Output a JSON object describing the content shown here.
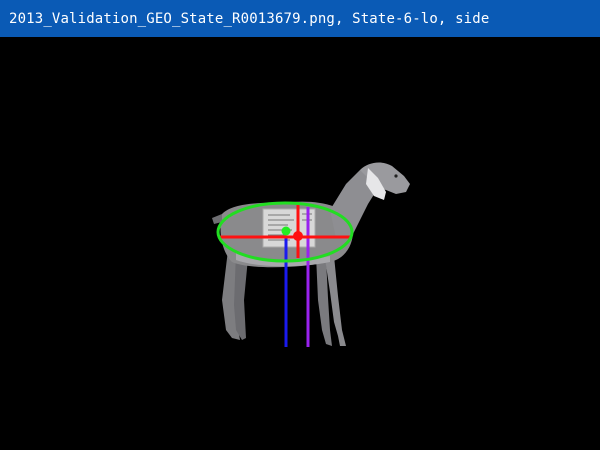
{
  "window": {
    "title": "2013_Validation_GEO_State_R0013679.png, State-6-lo, side"
  },
  "colors": {
    "titlebar": "#0a5ab5",
    "title_text": "#ffffff",
    "background": "#000000",
    "ellipse": "#22dd22",
    "crosshair": "#ff1111",
    "centroid_green": "#22ee22",
    "line_blue": "#1a1aee",
    "line_purple": "#9922ee",
    "animal_body": "#8a8a8c"
  },
  "icons": {
    "animal": "goat-image"
  }
}
